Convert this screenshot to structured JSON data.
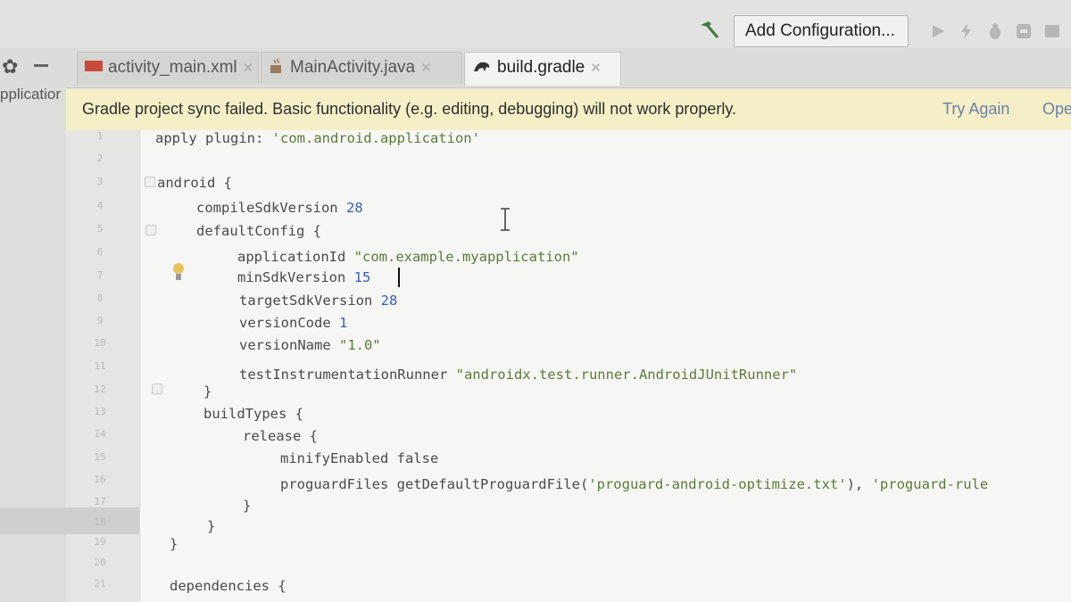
{
  "toolbar": {
    "add_config_label": "Add Configuration...",
    "icons": [
      "build-hammer-icon",
      "run-icon",
      "apply-changes-icon",
      "debug-icon",
      "profile-icon"
    ]
  },
  "sidebar": {
    "project_label": "pplicatior"
  },
  "tabs": [
    {
      "label": "activity_main.xml",
      "icon": "xml-file-icon",
      "active": false
    },
    {
      "label": "MainActivity.java",
      "icon": "java-file-icon",
      "active": false
    },
    {
      "label": "build.gradle",
      "icon": "gradle-file-icon",
      "active": true
    }
  ],
  "notification": {
    "message": "Gradle project sync failed. Basic functionality (e.g. editing, debugging) will not work properly.",
    "try_again": "Try Again",
    "open": "Ope"
  },
  "editor": {
    "line_numbers": [
      "1",
      "2",
      "3",
      "4",
      "5",
      "6",
      "7",
      "8",
      "9",
      "10",
      "11",
      "12",
      "13",
      "14",
      "15",
      "16",
      "17",
      "18",
      "19",
      "20",
      "21"
    ],
    "code": {
      "l1_kw": "apply plugin: ",
      "l1_str": "'com.android.application'",
      "l3": "android {",
      "l4_kw": "compileSdkVersion ",
      "l4_num": "28",
      "l5": "defaultConfig {",
      "l6_kw": "applicationId ",
      "l6_str": "\"com.example.myapplication\"",
      "l7_kw": "minSdkVersion ",
      "l7_num": "15",
      "l8_kw": "targetSdkVersion ",
      "l8_num": "28",
      "l9_kw": "versionCode ",
      "l9_num": "1",
      "l10_kw": "versionName ",
      "l10_str": "\"1.0\"",
      "l11_kw": "testInstrumentationRunner ",
      "l11_str": "\"androidx.test.runner.AndroidJUnitRunner\"",
      "l12": "}",
      "l13": "buildTypes {",
      "l14": "release {",
      "l15": "minifyEnabled false",
      "l16_kw": "proguardFiles getDefaultProguardFile(",
      "l16_str": "'proguard-android-optimize.txt'",
      "l16_mid": "), ",
      "l16_str2": "'proguard-rule",
      "l17": "}",
      "l18": "}",
      "l19": "}",
      "l21": "dependencies {"
    }
  },
  "colors": {
    "string": "#5c7a3a",
    "number": "#3a62b8",
    "notification_bg": "#f4efc6",
    "link": "#6d7fa8"
  }
}
